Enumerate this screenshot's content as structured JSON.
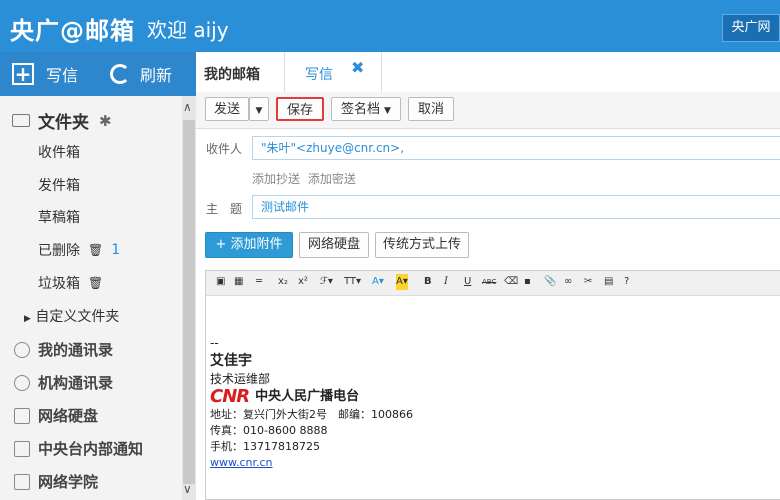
{
  "header": {
    "logo": "央广@邮箱",
    "welcome": "欢迎 aijy",
    "badge": "央广网"
  },
  "sidebar": {
    "write": "写信",
    "refresh": "刷新",
    "folders_title": "文件夹",
    "folders": [
      "收件箱",
      "发件箱",
      "草稿箱",
      "已删除",
      "垃圾箱"
    ],
    "deleted_count": "1",
    "custom_folders": "自定义文件夹",
    "sections": [
      "我的通讯录",
      "机构通讯录",
      "网络硬盘",
      "中央台内部通知",
      "网络学院"
    ]
  },
  "tabs": {
    "inbox": "我的邮箱",
    "write": "写信"
  },
  "toolbar": {
    "send": "发送",
    "save": "保存",
    "signature": "签名档",
    "cancel": "取消"
  },
  "compose": {
    "to_label": "收件人",
    "to_value": "\"朱叶\"<zhuye@cnr.cn>,",
    "add_cc": "添加抄送",
    "add_bcc": "添加密送",
    "subject_label": "主　题",
    "subject_value": "测试邮件"
  },
  "attach": {
    "add": "添加附件",
    "netdisk": "网络硬盘",
    "traditional": "传统方式上传"
  },
  "editor": {
    "tools": [
      "B",
      "I",
      "U",
      "ABC",
      "x₂",
      "x²",
      "TT",
      "A",
      "A"
    ],
    "body": {
      "dashes": "--",
      "name": "艾佳宇",
      "dept": "技术运维部",
      "logo_text": "CNR",
      "org": "中央人民广播电台",
      "address": "地址：复兴门外大街2号　邮编：100866",
      "fax": "传真：010-8600 8888",
      "mobile": "手机：13717818725",
      "site": "www.cnr.cn"
    }
  },
  "colors": {
    "header": "#2b8fd8",
    "accent": "#2e9bd6",
    "highlight": "#e43b3b"
  }
}
